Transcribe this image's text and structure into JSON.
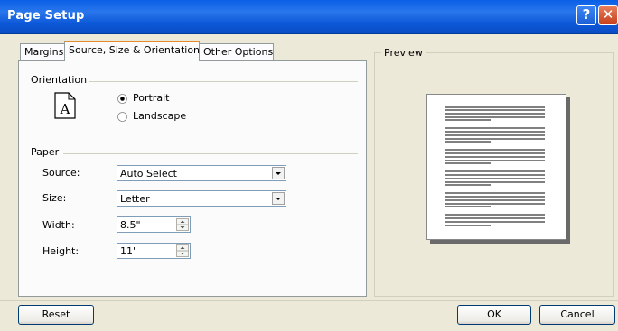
{
  "window": {
    "title": "Page Setup",
    "help_glyph": "?",
    "close_glyph": "✕"
  },
  "tabs": [
    {
      "label": "Margins",
      "active": false
    },
    {
      "label": "Source, Size & Orientation",
      "active": true
    },
    {
      "label": "Other Options",
      "active": false
    }
  ],
  "orientation": {
    "group_label": "Orientation",
    "portrait_label": "Portrait",
    "landscape_label": "Landscape",
    "selected": "Portrait",
    "icon_glyph": "A"
  },
  "paper": {
    "group_label": "Paper",
    "source": {
      "label": "Source:",
      "value": "Auto Select"
    },
    "size": {
      "label": "Size:",
      "value": "Letter"
    },
    "width": {
      "label": "Width:",
      "value": "8.5\""
    },
    "height": {
      "label": "Height:",
      "value": "11\""
    }
  },
  "preview": {
    "label": "Preview"
  },
  "buttons": {
    "reset": "Reset",
    "ok": "OK",
    "cancel": "Cancel"
  }
}
